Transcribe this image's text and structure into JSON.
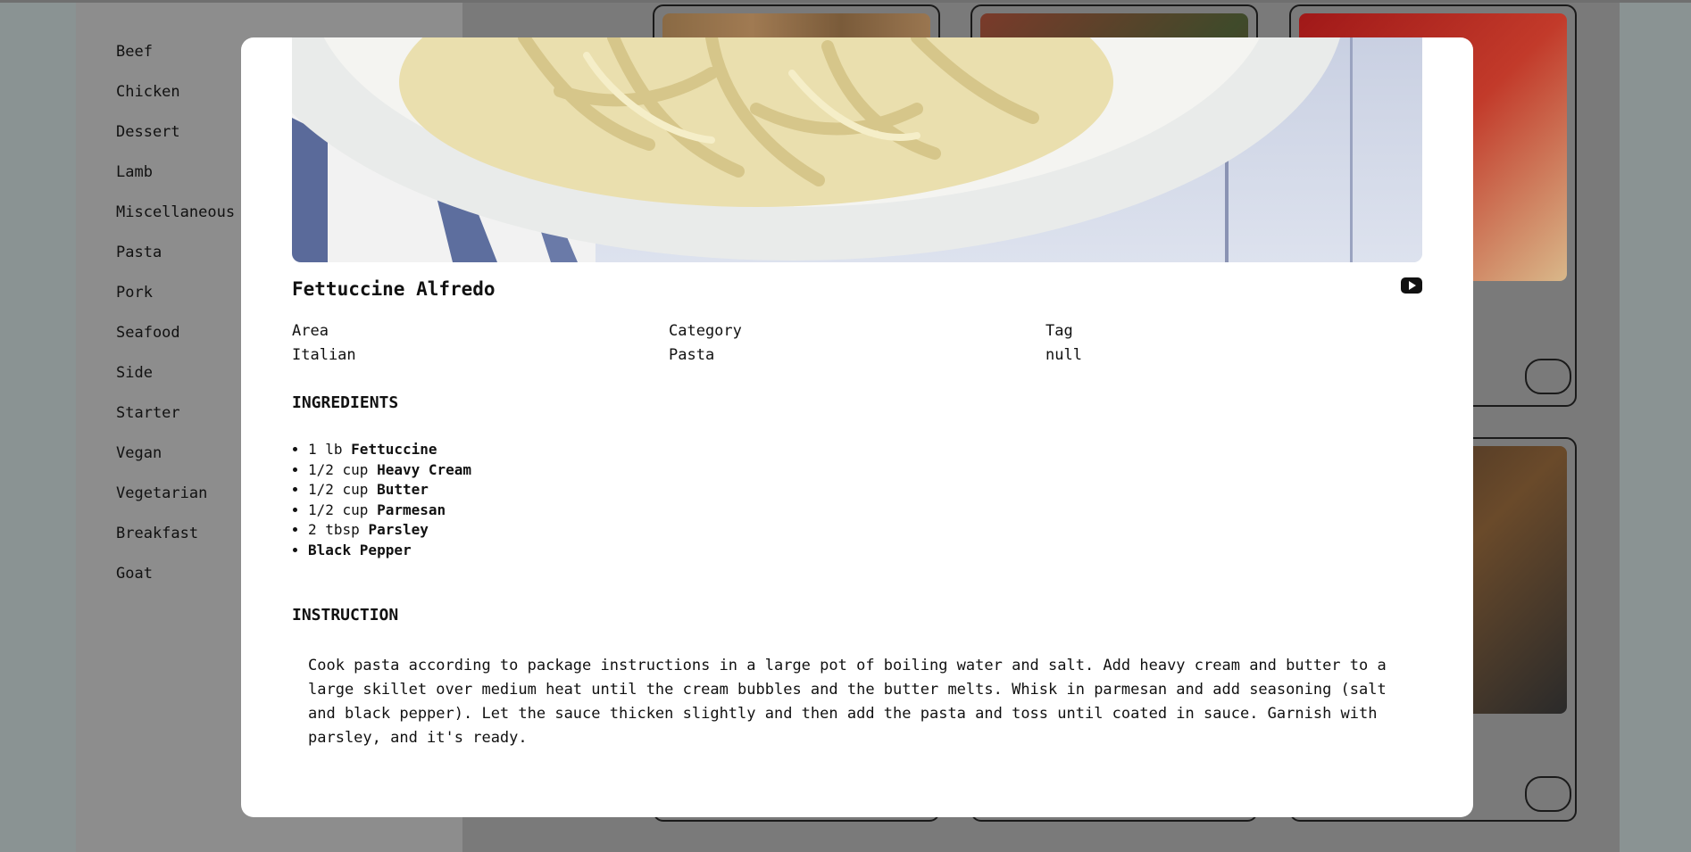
{
  "sidebar": {
    "categories": [
      "Beef",
      "Chicken",
      "Dessert",
      "Lamb",
      "Miscellaneous",
      "Pasta",
      "Pork",
      "Seafood",
      "Side",
      "Starter",
      "Vegan",
      "Vegetarian",
      "Breakfast",
      "Goat"
    ]
  },
  "meal": {
    "title": "Fettuccine Alfredo",
    "area_label": "Area",
    "area_value": "Italian",
    "category_label": "Category",
    "category_value": "Pasta",
    "tag_label": "Tag",
    "tag_value": "null",
    "ingredients_heading": "INGREDIENTS",
    "ingredients": [
      {
        "measure": "1 lb",
        "name": "Fettuccine"
      },
      {
        "measure": "1/2 cup",
        "name": "Heavy Cream"
      },
      {
        "measure": "1/2 cup",
        "name": "Butter"
      },
      {
        "measure": "1/2 cup",
        "name": "Parmesan"
      },
      {
        "measure": "2 tbsp",
        "name": "Parsley"
      },
      {
        "measure": "",
        "name": "Black Pepper"
      }
    ],
    "instruction_heading": "INSTRUCTION",
    "instruction": "Cook pasta according to package instructions in a large pot of boiling water and salt. Add heavy cream and butter to a large skillet over medium heat until the cream bubbles and the butter melts. Whisk in parmesan and add seasoning (salt and black pepper). Let the sauce thicken slightly and then add the pasta and toss until coated in sauce. Garnish with parsley, and it's ready."
  },
  "icons": {
    "video": "youtube-icon"
  },
  "colors": {
    "overlay": "#7a7a7a",
    "modal_bg": "#ffffff",
    "text": "#111111"
  }
}
